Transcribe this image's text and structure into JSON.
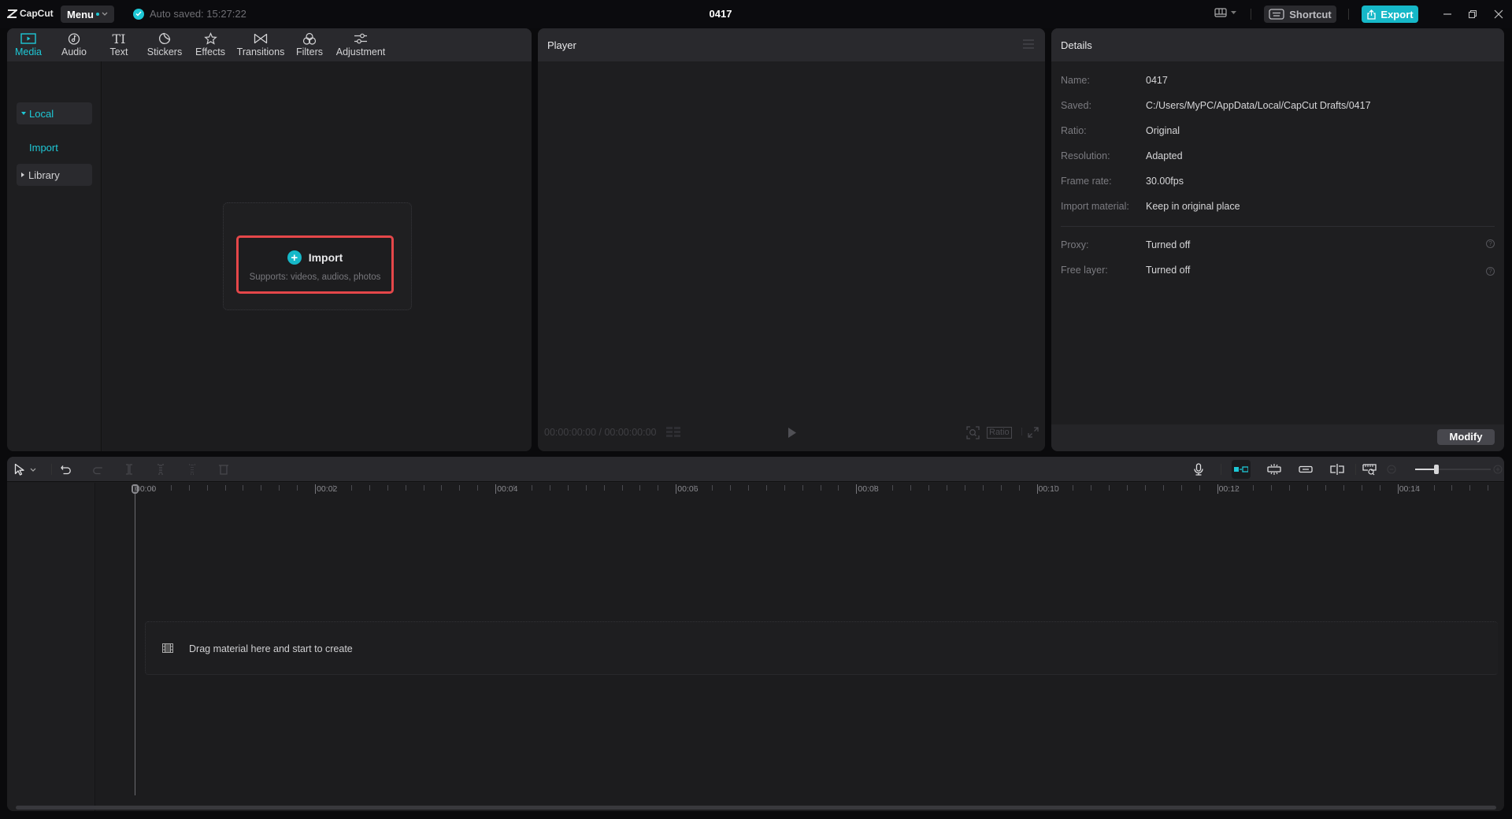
{
  "app": {
    "logo_text": "CapCut",
    "menu_label": "Menu",
    "autosave_text": "Auto saved: 15:27:22",
    "project_title": "0417",
    "shortcut_label": "Shortcut",
    "export_label": "Export"
  },
  "colors": {
    "accent": "#1ec8d6",
    "export": "#16b8c8",
    "highlight_border": "#e5474a"
  },
  "media_panel": {
    "tabs": [
      {
        "label": "Media",
        "icon": "media-icon",
        "active": true
      },
      {
        "label": "Audio",
        "icon": "audio-icon"
      },
      {
        "label": "Text",
        "icon": "text-icon"
      },
      {
        "label": "Stickers",
        "icon": "stickers-icon"
      },
      {
        "label": "Effects",
        "icon": "effects-icon"
      },
      {
        "label": "Transitions",
        "icon": "transitions-icon"
      },
      {
        "label": "Filters",
        "icon": "filters-icon"
      },
      {
        "label": "Adjustment",
        "icon": "adjustment-icon"
      }
    ],
    "sidebar": {
      "local_label": "Local",
      "import_label": "Import",
      "library_label": "Library"
    },
    "import_box": {
      "title": "Import",
      "subtitle": "Supports: videos, audios, photos"
    }
  },
  "player": {
    "title": "Player",
    "timecode": "00:00:00:00 / 00:00:00:00",
    "ratio_label": "Ratio"
  },
  "details": {
    "title": "Details",
    "rows": [
      {
        "label": "Name:",
        "value": "0417"
      },
      {
        "label": "Saved:",
        "value": "C:/Users/MyPC/AppData/Local/CapCut Drafts/0417"
      },
      {
        "label": "Ratio:",
        "value": "Original"
      },
      {
        "label": "Resolution:",
        "value": "Adapted"
      },
      {
        "label": "Frame rate:",
        "value": "30.00fps"
      },
      {
        "label": "Import material:",
        "value": "Keep in original place"
      }
    ],
    "extra_rows": [
      {
        "label": "Proxy:",
        "value": "Turned off"
      },
      {
        "label": "Free layer:",
        "value": "Turned off"
      }
    ],
    "modify_label": "Modify"
  },
  "timeline": {
    "ruler_labels": [
      "00:00",
      "00:02",
      "00:04",
      "00:06",
      "00:08",
      "00:10",
      "00:12",
      "00:14"
    ],
    "drop_text": "Drag material here and start to create",
    "zoom_level": 0.1
  }
}
